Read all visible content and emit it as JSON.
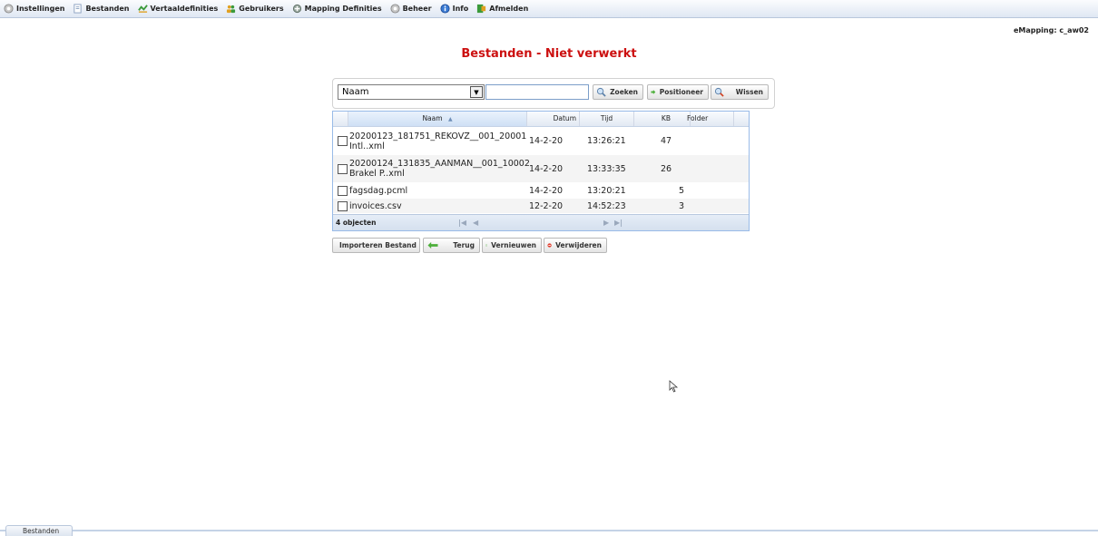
{
  "menu": [
    {
      "label": "Instellingen",
      "icon": "gear-icon"
    },
    {
      "label": "Bestanden",
      "icon": "file-icon"
    },
    {
      "label": "Vertaaldefinities",
      "icon": "translation-icon"
    },
    {
      "label": "Gebruikers",
      "icon": "users-icon"
    },
    {
      "label": "Mapping Definities",
      "icon": "mapping-icon"
    },
    {
      "label": "Beheer",
      "icon": "gear-icon"
    },
    {
      "label": "Info",
      "icon": "info-icon"
    },
    {
      "label": "Afmelden",
      "icon": "logout-icon"
    }
  ],
  "user_label": "eMapping: c_aw02",
  "page_title": "Bestanden - Niet verwerkt",
  "search": {
    "field_selected": "Naam",
    "input_value": "",
    "zoeken_label": "Zoeken",
    "positioneer_label": "Positioneer",
    "wissen_label": "Wissen"
  },
  "grid": {
    "columns": [
      "Naam",
      "Datum",
      "Tijd",
      "KB",
      "Folder"
    ],
    "rows": [
      {
        "name_line1": "20200123_181751_REKOVZ__001_20001",
        "name_line2": "Intl..xml",
        "datum": "14-2-20",
        "tijd": "13:26:21",
        "kb": "47",
        "folder": ""
      },
      {
        "name_line1": "20200124_131835_AANMAN__001_10002",
        "name_line2": "Brakel P..xml",
        "datum": "14-2-20",
        "tijd": "13:33:35",
        "kb": "26",
        "folder": ""
      },
      {
        "name_line1": "fagsdag.pcml",
        "name_line2": "",
        "datum": "14-2-20",
        "tijd": "13:20:21",
        "kb": "5",
        "folder": ""
      },
      {
        "name_line1": "invoices.csv",
        "name_line2": "",
        "datum": "12-2-20",
        "tijd": "14:52:23",
        "kb": "3",
        "folder": ""
      }
    ],
    "footer_count": "4 objecten"
  },
  "actions": {
    "importeren_label": "Importeren Bestand",
    "terug_label": "Terug",
    "vernieuwen_label": "Vernieuwen",
    "verwijderen_label": "Verwijderen"
  },
  "bottom_tab_label": "Bestanden",
  "colors": {
    "title": "#cc1010",
    "grid_border": "#99bbe8"
  }
}
